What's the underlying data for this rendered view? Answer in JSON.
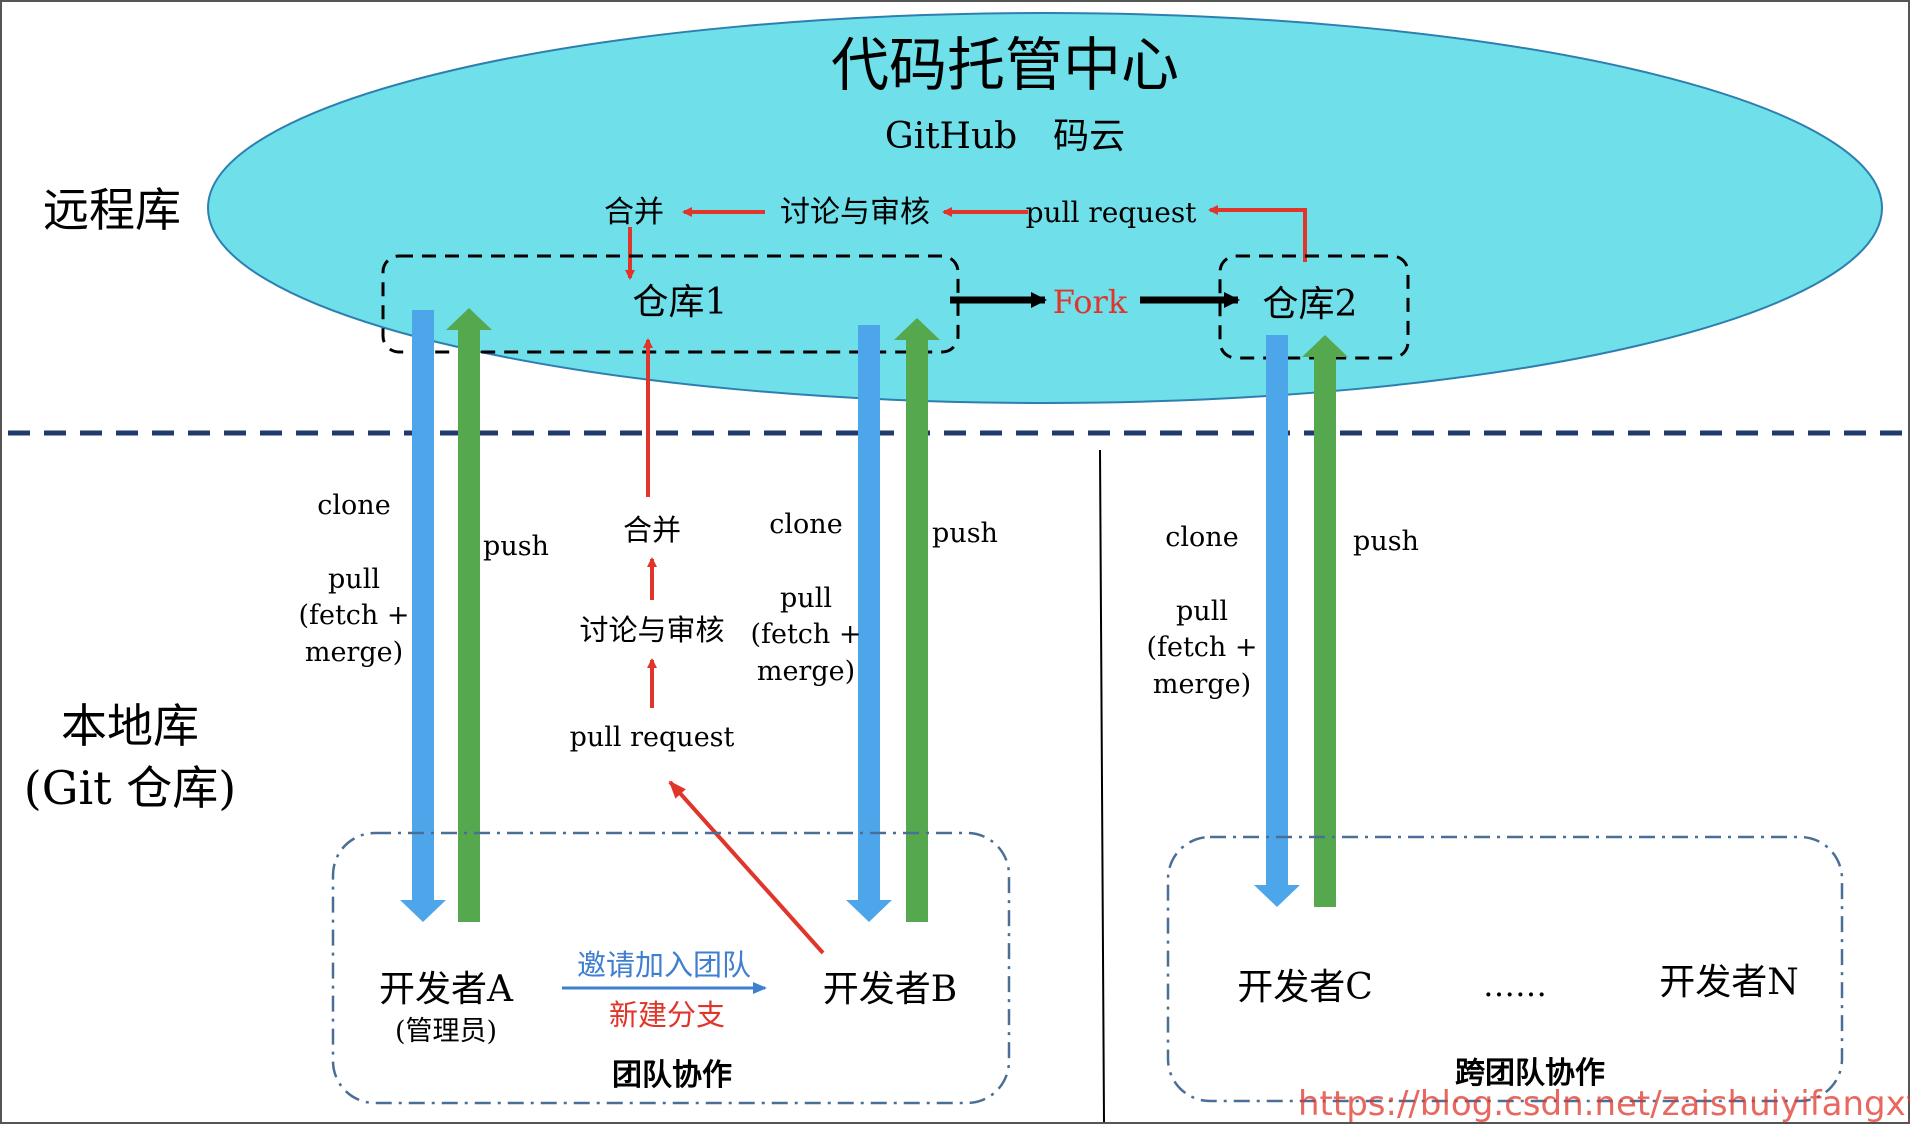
{
  "cloud": {
    "title": "代码托管中心",
    "subtitle": "GitHub　码云"
  },
  "labels": {
    "remote": "远程库",
    "local_line1": "本地库",
    "local_line2": "(Git 仓库)"
  },
  "remote_flow": {
    "merge": "合并",
    "review": "讨论与审核",
    "pull_request": "pull request"
  },
  "repos": {
    "repo1": "仓库1",
    "repo2": "仓库2",
    "fork": "Fork"
  },
  "ops": {
    "clone": "clone",
    "pull": "pull",
    "fetch": "(fetch +",
    "merge": "merge)",
    "push": "push"
  },
  "local_flow": {
    "merge": "合并",
    "review": "讨论与审核",
    "pull_request": "pull request"
  },
  "developers": {
    "a": "开发者A",
    "a_role": "(管理员)",
    "b": "开发者B",
    "c": "开发者C",
    "ellipsis": "……",
    "n": "开发者N"
  },
  "team": {
    "invite": "邀请加入团队",
    "branch": "新建分支",
    "team_label": "团队协作",
    "cross_team_label": "跨团队协作"
  },
  "watermark": "https://blog.csdn.net/zaishuiyifangxym",
  "colors": {
    "cloud_fill": "#6fdfea",
    "blue_arrow": "#4ea6ea",
    "green_arrow": "#56a84f",
    "red": "#e0352b",
    "invite_blue": "#3f7fd0",
    "divider": "#1f3a6b",
    "team_box": "#4a6f96"
  }
}
